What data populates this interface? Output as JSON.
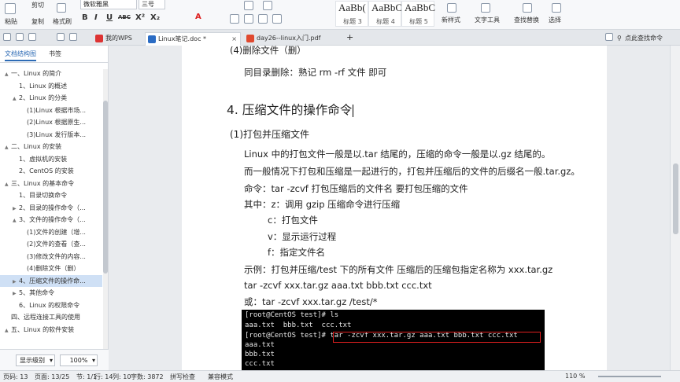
{
  "ribbon": {
    "paste": "粘贴",
    "cut": "剪切",
    "copy": "复制",
    "format_painter": "格式刷",
    "font_name": "微软雅黑",
    "font_size": "三号",
    "bold": "B",
    "italic": "I",
    "underline": "U",
    "strike": "ABC",
    "superscript": "X²",
    "subscript": "X₂",
    "font_color": "A",
    "styles": [
      {
        "preview": "AaBb(",
        "name": "标题 3"
      },
      {
        "preview": "AaBbC",
        "name": "标题 4"
      },
      {
        "preview": "AaBbC",
        "name": "标题 5"
      }
    ],
    "new_style": "新样式",
    "text_tools": "文字工具",
    "find_replace": "查找替换",
    "select": "选择"
  },
  "tabs": {
    "my_wps": "我的WPS",
    "doc1": "Linux笔记.doc *",
    "doc2": "day26--linux入门.pdf",
    "add": "+",
    "search": "点此查找命令"
  },
  "nav": {
    "tab_outline": "文档结构图",
    "tab_bookmark": "书签",
    "items": [
      {
        "label": "一、Linux 的简介",
        "level": 0,
        "expand": "▲"
      },
      {
        "label": "1、Linux 的概述",
        "level": 1,
        "expand": ""
      },
      {
        "label": "2、Linux 的分类",
        "level": 1,
        "expand": "▲"
      },
      {
        "label": "(1)Linux 根据市场...",
        "level": 2,
        "expand": ""
      },
      {
        "label": "(2)Linux 根据原生...",
        "level": 2,
        "expand": ""
      },
      {
        "label": "(3)Linux 发行版本...",
        "level": 2,
        "expand": ""
      },
      {
        "label": "二、Linux 的安装",
        "level": 0,
        "expand": "▲"
      },
      {
        "label": "1、虚拟机的安装",
        "level": 1,
        "expand": ""
      },
      {
        "label": "2、CentOS 的安装",
        "level": 1,
        "expand": ""
      },
      {
        "label": "三、Linux 的基本命令",
        "level": 0,
        "expand": "▲"
      },
      {
        "label": "1、目录切换命令",
        "level": 1,
        "expand": ""
      },
      {
        "label": "2、目录的操作命令（...",
        "level": 1,
        "expand": "▶"
      },
      {
        "label": "3、文件的操作命令（...",
        "level": 1,
        "expand": "▲"
      },
      {
        "label": "(1)文件的创建（增...",
        "level": 2,
        "expand": ""
      },
      {
        "label": "(2)文件的查看（查...",
        "level": 2,
        "expand": ""
      },
      {
        "label": "(3)修改文件的内容...",
        "level": 2,
        "expand": ""
      },
      {
        "label": "(4)删除文件（删）",
        "level": 2,
        "expand": ""
      },
      {
        "label": "4、压缩文件的操作命...",
        "level": 1,
        "expand": "▶",
        "selected": true
      },
      {
        "label": "5、其他命令",
        "level": 1,
        "expand": "▶"
      },
      {
        "label": "6、Linux 的权限命令",
        "level": 1,
        "expand": ""
      },
      {
        "label": "四、远程连接工具的使用",
        "level": 0,
        "expand": ""
      },
      {
        "label": "五、Linux 的软件安装",
        "level": 0,
        "expand": "▲"
      }
    ],
    "display_level": "显示级别",
    "zoom": "100%"
  },
  "doc": {
    "line_delete_heading": "(4)删除文件（删）",
    "line_delete_body": "同目录删除：熟记  rm -rf  文件  即可",
    "heading": "4.  压缩文件的操作命令",
    "subheading": "(1)打包并压缩文件",
    "p1": "Linux 中的打包文件一般是以.tar 结尾的，压缩的命令一般是以.gz 结尾的。",
    "p2": "而一般情况下打包和压缩是一起进行的，打包并压缩后的文件的后缀名一般.tar.gz。",
    "p3": "命令：tar -zcvf  打包压缩后的文件名  要打包压缩的文件",
    "p4": "其中：z：调用 gzip 压缩命令进行压缩",
    "p5": "c：打包文件",
    "p6": "v：显示运行过程",
    "p7": "f：指定文件名",
    "p8": "示例：打包并压缩/test 下的所有文件  压缩后的压缩包指定名称为 xxx.tar.gz",
    "p9": "tar -zcvf xxx.tar.gz aaa.txt bbb.txt ccc.txt",
    "p10": "或：tar -zcvf xxx.tar.gz /test/*"
  },
  "terminal": {
    "lines": [
      "[root@CentOS test]# ls",
      "aaa.txt  bbb.txt  ccc.txt",
      "[root@CentOS test]# tar -zcvf xxx.tar.gz aaa.txt bbb.txt ccc.txt",
      "aaa.txt",
      "bbb.txt",
      "ccc.txt"
    ]
  },
  "status": {
    "page": "页码: 13",
    "pages": "页面: 13/25",
    "section": "节: 1/1",
    "row": "行: 14",
    "col": "列: 10",
    "words": "字数: 3872",
    "spell": "拼写检查",
    "compat": "兼容模式",
    "zoom": "110 %"
  }
}
